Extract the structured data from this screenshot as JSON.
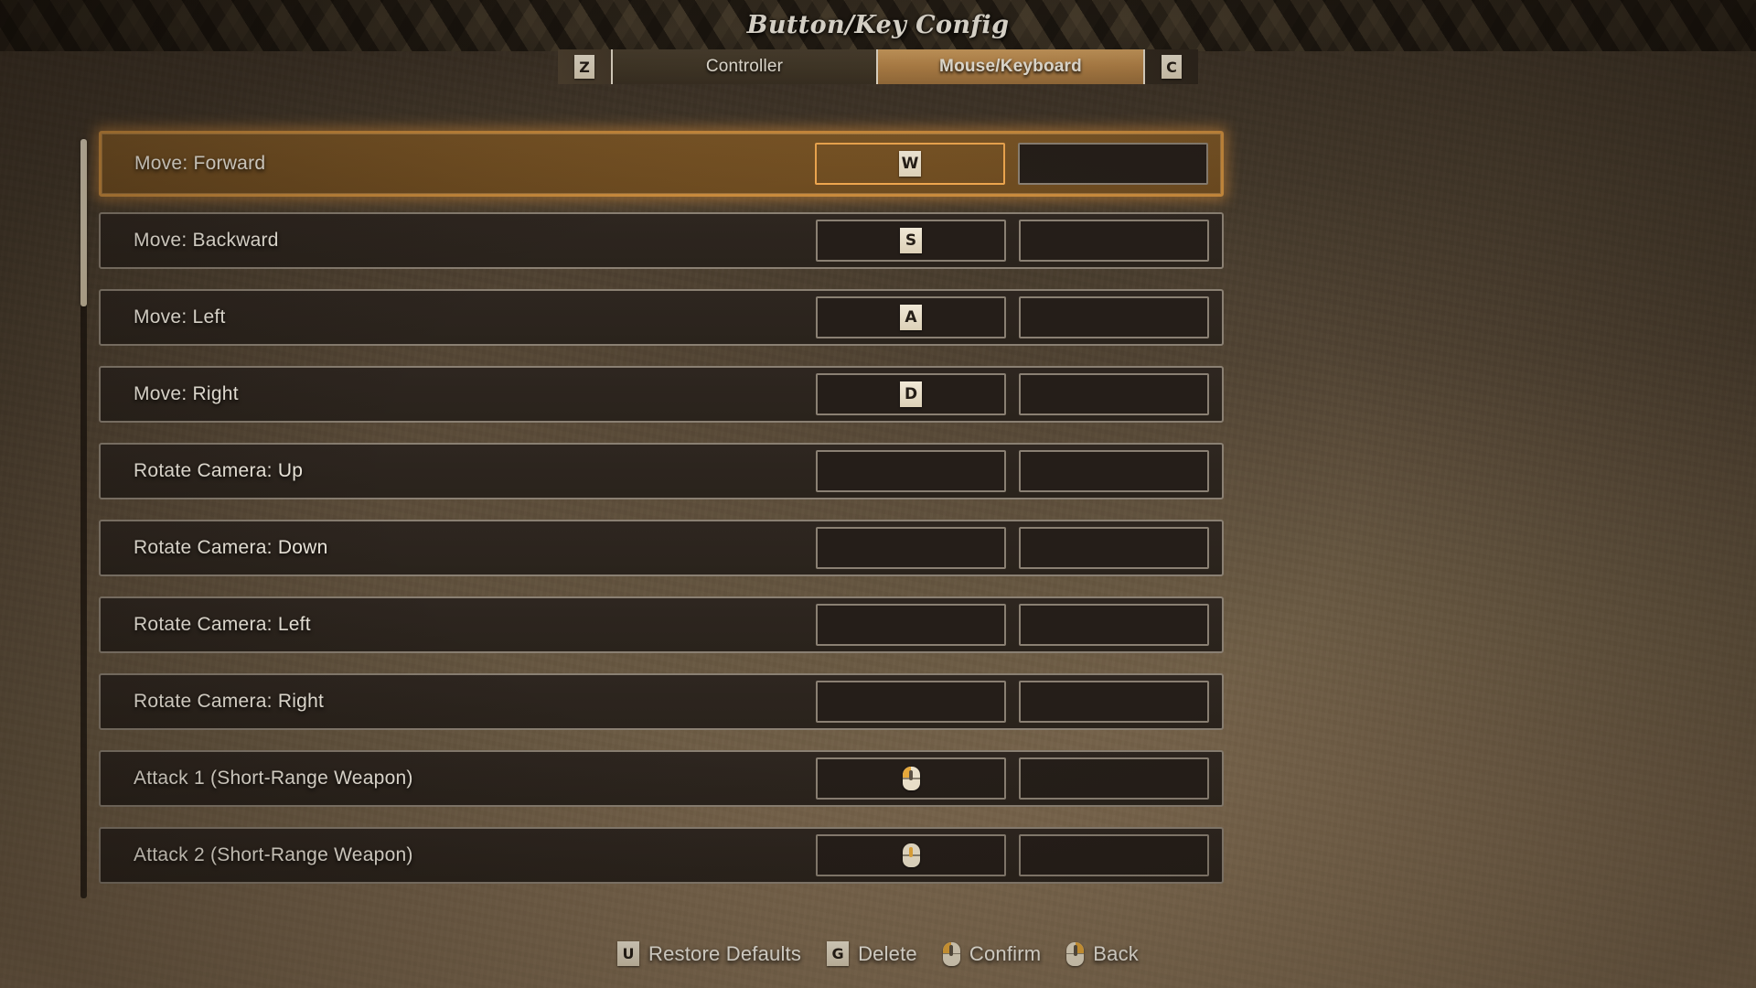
{
  "header": {
    "title": "Button/Key Config"
  },
  "tabbar": {
    "left_key": "Z",
    "right_key": "C",
    "tabs": [
      {
        "label": "Controller",
        "active": false
      },
      {
        "label": "Mouse/Keyboard",
        "active": true
      }
    ]
  },
  "bindings": {
    "rows": [
      {
        "action": "Move: Forward",
        "primary": {
          "type": "key",
          "value": "W"
        },
        "secondary": {
          "type": "empty"
        },
        "selected": true
      },
      {
        "action": "Move: Backward",
        "primary": {
          "type": "key",
          "value": "S"
        },
        "secondary": {
          "type": "empty"
        },
        "selected": false
      },
      {
        "action": "Move: Left",
        "primary": {
          "type": "key",
          "value": "A"
        },
        "secondary": {
          "type": "empty"
        },
        "selected": false
      },
      {
        "action": "Move: Right",
        "primary": {
          "type": "key",
          "value": "D"
        },
        "secondary": {
          "type": "empty"
        },
        "selected": false
      },
      {
        "action": "Rotate Camera: Up",
        "primary": {
          "type": "empty"
        },
        "secondary": {
          "type": "empty"
        },
        "selected": false
      },
      {
        "action": "Rotate Camera: Down",
        "primary": {
          "type": "empty"
        },
        "secondary": {
          "type": "empty"
        },
        "selected": false
      },
      {
        "action": "Rotate Camera: Left",
        "primary": {
          "type": "empty"
        },
        "secondary": {
          "type": "empty"
        },
        "selected": false
      },
      {
        "action": "Rotate Camera: Right",
        "primary": {
          "type": "empty"
        },
        "secondary": {
          "type": "empty"
        },
        "selected": false
      },
      {
        "action": "Attack 1 (Short-Range Weapon)",
        "primary": {
          "type": "mouse",
          "value": "mouse-left"
        },
        "secondary": {
          "type": "empty"
        },
        "selected": false
      },
      {
        "action": "Attack 2 (Short-Range Weapon)",
        "primary": {
          "type": "mouse",
          "value": "mouse-wheel"
        },
        "secondary": {
          "type": "empty"
        },
        "selected": false
      }
    ]
  },
  "footer": {
    "items": [
      {
        "glyph_type": "key",
        "glyph": "U",
        "label": "Restore Defaults"
      },
      {
        "glyph_type": "key",
        "glyph": "G",
        "label": "Delete"
      },
      {
        "glyph_type": "mouse",
        "glyph": "mouse-left",
        "label": "Confirm"
      },
      {
        "glyph_type": "mouse",
        "glyph": "mouse-right",
        "label": "Back"
      }
    ]
  },
  "scrollbar": {
    "thumb_position_pct": 0,
    "thumb_size_pct": 22
  },
  "colors": {
    "accent": "#c98b3d",
    "accent_bright": "#eda64f",
    "tab_active_top": "#d2a161",
    "key_cap": "#f0e8d6",
    "row_bg": "#2e2620",
    "row_selected_bg": "#7a5526",
    "border": "#8a8073",
    "text": "#f6f1e6",
    "mouse_highlight": "#e8a93a"
  }
}
